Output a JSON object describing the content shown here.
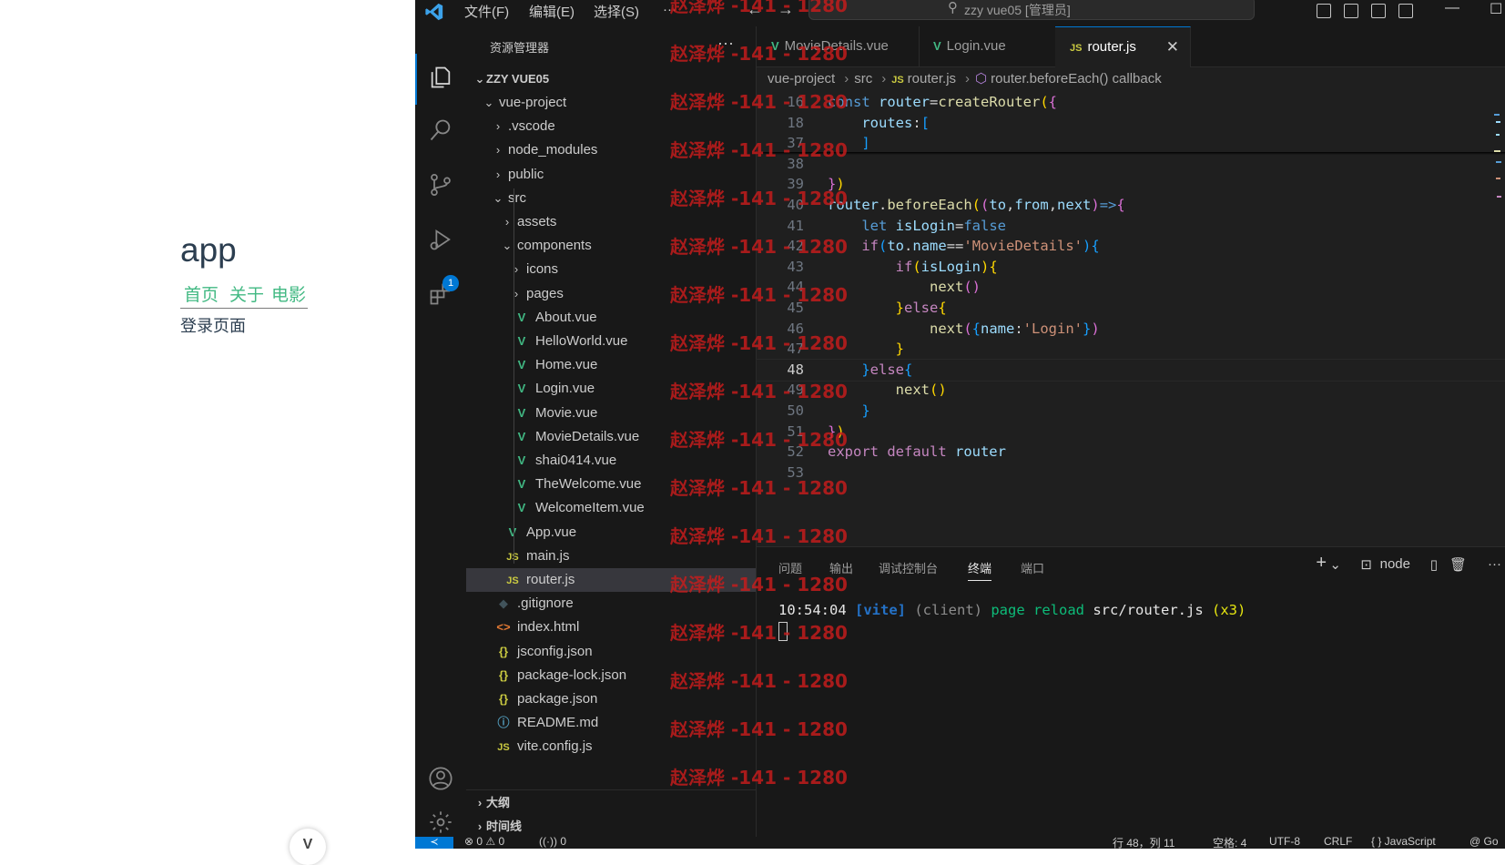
{
  "browser": {
    "app_title": "app",
    "nav": [
      "首页",
      "关于",
      "电影"
    ],
    "page_text": "登录页面",
    "devtools_glyph": "V"
  },
  "titlebar": {
    "menus": [
      "文件(F)",
      "编辑(E)",
      "选择(S)",
      "···"
    ],
    "search_text": "zzy vue05 [管理员]",
    "back_glyph": "←",
    "forward_glyph": "→",
    "minimize_glyph": "—",
    "maximize_glyph": "☐"
  },
  "activity": {
    "extensions_badge": "1"
  },
  "sidebar": {
    "title": "资源管理器",
    "more": "···",
    "root": "ZZY VUE05",
    "tree": [
      {
        "label": "vue-project",
        "indent": 1,
        "chevron": "⌄",
        "icon": ""
      },
      {
        "label": ".vscode",
        "indent": 2,
        "chevron": "›",
        "icon": ""
      },
      {
        "label": "node_modules",
        "indent": 2,
        "chevron": "›",
        "icon": ""
      },
      {
        "label": "public",
        "indent": 2,
        "chevron": "›",
        "icon": ""
      },
      {
        "label": "src",
        "indent": 2,
        "chevron": "⌄",
        "icon": ""
      },
      {
        "label": "assets",
        "indent": 3,
        "chevron": "›",
        "icon": ""
      },
      {
        "label": "components",
        "indent": 3,
        "chevron": "⌄",
        "icon": ""
      },
      {
        "label": "icons",
        "indent": 4,
        "chevron": "›",
        "icon": ""
      },
      {
        "label": "pages",
        "indent": 4,
        "chevron": "›",
        "icon": ""
      },
      {
        "label": "About.vue",
        "indent": 4,
        "chevron": "",
        "icon": "vue"
      },
      {
        "label": "HelloWorld.vue",
        "indent": 4,
        "chevron": "",
        "icon": "vue"
      },
      {
        "label": "Home.vue",
        "indent": 4,
        "chevron": "",
        "icon": "vue"
      },
      {
        "label": "Login.vue",
        "indent": 4,
        "chevron": "",
        "icon": "vue"
      },
      {
        "label": "Movie.vue",
        "indent": 4,
        "chevron": "",
        "icon": "vue"
      },
      {
        "label": "MovieDetails.vue",
        "indent": 4,
        "chevron": "",
        "icon": "vue"
      },
      {
        "label": "shai0414.vue",
        "indent": 4,
        "chevron": "",
        "icon": "vue"
      },
      {
        "label": "TheWelcome.vue",
        "indent": 4,
        "chevron": "",
        "icon": "vue"
      },
      {
        "label": "WelcomeItem.vue",
        "indent": 4,
        "chevron": "",
        "icon": "vue"
      },
      {
        "label": "App.vue",
        "indent": 3,
        "chevron": "",
        "icon": "vue"
      },
      {
        "label": "main.js",
        "indent": 3,
        "chevron": "",
        "icon": "js"
      },
      {
        "label": "router.js",
        "indent": 3,
        "chevron": "",
        "icon": "js",
        "selected": true
      },
      {
        "label": ".gitignore",
        "indent": 2,
        "chevron": "",
        "icon": "git"
      },
      {
        "label": "index.html",
        "indent": 2,
        "chevron": "",
        "icon": "html"
      },
      {
        "label": "jsconfig.json",
        "indent": 2,
        "chevron": "",
        "icon": "json"
      },
      {
        "label": "package-lock.json",
        "indent": 2,
        "chevron": "",
        "icon": "json"
      },
      {
        "label": "package.json",
        "indent": 2,
        "chevron": "",
        "icon": "json"
      },
      {
        "label": "README.md",
        "indent": 2,
        "chevron": "",
        "icon": "info"
      },
      {
        "label": "vite.config.js",
        "indent": 2,
        "chevron": "",
        "icon": "js"
      }
    ],
    "outline": "大纲",
    "timeline": "时间线"
  },
  "icons": {
    "vue": "V",
    "js": "JS",
    "git": "◆",
    "html": "<>",
    "json": "{}",
    "info": "ⓘ"
  },
  "editor": {
    "tabs": [
      {
        "label": "MovieDetails.vue",
        "icon": "V"
      },
      {
        "label": "Login.vue",
        "icon": "V"
      },
      {
        "label": "router.js",
        "icon": "JS",
        "active": true
      }
    ],
    "close_glyph": "✕",
    "breadcrumb": [
      "vue-project",
      "src",
      "router.js",
      "router.beforeEach() callback"
    ],
    "breadcrumb_js": "JS",
    "lines": [
      {
        "n": "16",
        "tokens": [
          [
            "const ",
            "k-blue"
          ],
          [
            "router",
            "k-var"
          ],
          [
            "=",
            "k-white"
          ],
          [
            "createRouter",
            "k-fn"
          ],
          [
            "(",
            "k-gold"
          ],
          [
            "{",
            "k-pink"
          ]
        ]
      },
      {
        "n": "18",
        "tokens": [
          [
            "    routes",
            "k-var"
          ],
          [
            ":",
            "k-white"
          ],
          [
            "[",
            "k-bl2"
          ]
        ]
      },
      {
        "n": "37",
        "tokens": [
          [
            "    ]",
            "k-bl2"
          ]
        ]
      },
      {
        "n": "38",
        "tokens": []
      },
      {
        "n": "39",
        "tokens": [
          [
            "}",
            "k-pink"
          ],
          [
            ")",
            "k-gold"
          ]
        ]
      },
      {
        "n": "40",
        "tokens": [
          [
            "router",
            "k-var"
          ],
          [
            ".",
            "k-white"
          ],
          [
            "beforeEach",
            "k-fn"
          ],
          [
            "(",
            "k-gold"
          ],
          [
            "(",
            "k-pink"
          ],
          [
            "to",
            "k-var"
          ],
          [
            ",",
            "k-white"
          ],
          [
            "from",
            "k-var"
          ],
          [
            ",",
            "k-white"
          ],
          [
            "next",
            "k-var"
          ],
          [
            ")",
            "k-pink"
          ],
          [
            "=>",
            "k-blue"
          ],
          [
            "{",
            "k-pink"
          ]
        ]
      },
      {
        "n": "41",
        "tokens": [
          [
            "    let ",
            "k-blue"
          ],
          [
            "isLogin",
            "k-var"
          ],
          [
            "=",
            "k-white"
          ],
          [
            "false",
            "k-blue"
          ]
        ]
      },
      {
        "n": "42",
        "tokens": [
          [
            "    if",
            "k-purp"
          ],
          [
            "(",
            "k-bl2"
          ],
          [
            "to",
            "k-var"
          ],
          [
            ".",
            "k-white"
          ],
          [
            "name",
            "k-var"
          ],
          [
            "==",
            "k-white"
          ],
          [
            "'MovieDetails'",
            "k-str"
          ],
          [
            ")",
            "k-bl2"
          ],
          [
            "{",
            "k-bl2"
          ]
        ]
      },
      {
        "n": "43",
        "tokens": [
          [
            "        if",
            "k-purp"
          ],
          [
            "(",
            "k-gold"
          ],
          [
            "isLogin",
            "k-var"
          ],
          [
            ")",
            "k-gold"
          ],
          [
            "{",
            "k-gold"
          ]
        ]
      },
      {
        "n": "44",
        "tokens": [
          [
            "            next",
            "k-fn"
          ],
          [
            "()",
            "k-pink"
          ]
        ]
      },
      {
        "n": "45",
        "tokens": [
          [
            "        }",
            "k-gold"
          ],
          [
            "else",
            "k-purp"
          ],
          [
            "{",
            "k-gold"
          ]
        ]
      },
      {
        "n": "46",
        "tokens": [
          [
            "            next",
            "k-fn"
          ],
          [
            "(",
            "k-pink"
          ],
          [
            "{",
            "k-bl2"
          ],
          [
            "name",
            "k-var"
          ],
          [
            ":",
            "k-white"
          ],
          [
            "'Login'",
            "k-str"
          ],
          [
            "}",
            "k-bl2"
          ],
          [
            ")",
            "k-pink"
          ]
        ]
      },
      {
        "n": "47",
        "tokens": [
          [
            "        }",
            "k-gold"
          ]
        ]
      },
      {
        "n": "48",
        "tokens": [
          [
            "    }",
            "k-bl2"
          ],
          [
            "else",
            "k-purp"
          ],
          [
            "{",
            "k-bl2"
          ]
        ],
        "current": true
      },
      {
        "n": "49",
        "tokens": [
          [
            "        next",
            "k-fn"
          ],
          [
            "()",
            "k-gold"
          ]
        ]
      },
      {
        "n": "50",
        "tokens": [
          [
            "    }",
            "k-bl2"
          ]
        ]
      },
      {
        "n": "51",
        "tokens": [
          [
            "}",
            "k-pink"
          ],
          [
            ")",
            "k-gold"
          ]
        ]
      },
      {
        "n": "52",
        "tokens": [
          [
            "export ",
            "k-purp"
          ],
          [
            "default ",
            "k-purp"
          ],
          [
            "router",
            "k-var"
          ]
        ]
      },
      {
        "n": "53",
        "tokens": []
      }
    ]
  },
  "panel": {
    "tabs": [
      "问题",
      "输出",
      "调试控制台",
      "终端",
      "端口"
    ],
    "active_tab": "终端",
    "actions": {
      "add": "+",
      "dropdown": "⌄",
      "shell": "node",
      "split": "▯",
      "trash": "🗑",
      "more": "···",
      "shell_icon": "⊡"
    },
    "terminal": {
      "time": "10:54:04",
      "tag": "[vite]",
      "client": "(client)",
      "msg": "page reload",
      "file": "src/router.js",
      "count": "(x3)"
    }
  },
  "statusbar": {
    "remote": "≺",
    "problems": "⊗ 0 ⚠ 0",
    "ports": "((·)) 0",
    "line": "行 48，列 11",
    "spaces": "空格: 4",
    "encoding": "UTF-8",
    "eol": "CRLF",
    "language": "{ } JavaScript",
    "copilot": "@ Go"
  },
  "watermark": "赵泽烨 -141 - 1280"
}
